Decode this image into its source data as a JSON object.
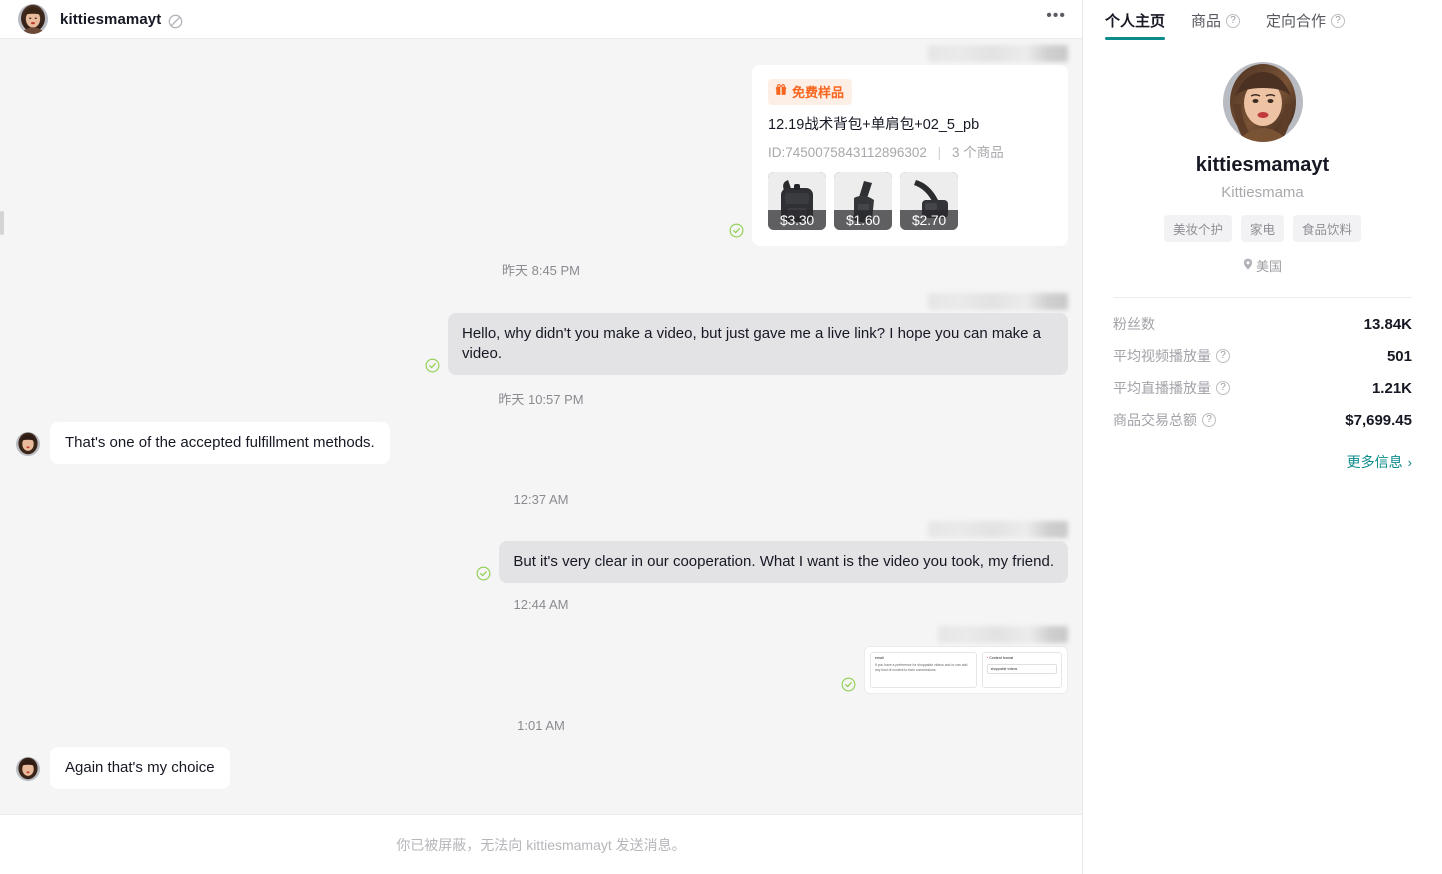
{
  "chat": {
    "header": {
      "username": "kittiesmamayt",
      "ban_icon": "prohibited-icon",
      "more_label": "•••"
    },
    "messages": [
      {
        "kind": "product-card",
        "direction": "out",
        "badge": "免费样品",
        "title": "12.19战术背包+单肩包+02_5_pb",
        "id_text": "ID:7450075843112896302",
        "count_text": "3 个商品",
        "thumbs": [
          {
            "price": "$3.30",
            "alt": "tactical-backpack"
          },
          {
            "price": "$1.60",
            "alt": "sling-bag"
          },
          {
            "price": "$2.70",
            "alt": "shoulder-bag"
          }
        ]
      },
      {
        "kind": "timestamp",
        "text": "昨天 8:45 PM"
      },
      {
        "kind": "text",
        "direction": "out",
        "text": "Hello, why didn't you make a video, but just gave me a live link? I hope you can make a video."
      },
      {
        "kind": "timestamp",
        "text": "昨天 10:57 PM"
      },
      {
        "kind": "text",
        "direction": "in",
        "text": "That's one of the accepted fulfillment methods."
      },
      {
        "kind": "timestamp",
        "text": "12:37 AM"
      },
      {
        "kind": "text",
        "direction": "out",
        "text": "But it's very clear in our cooperation. What I want is the video you took, my friend."
      },
      {
        "kind": "timestamp",
        "text": "12:44 AM"
      },
      {
        "kind": "image",
        "direction": "out",
        "screenshot": {
          "left_label": "email",
          "left_body": "If you have a preference for shoppable videos and or can add any kind of content to earn commissions.",
          "right_label": "Content format",
          "right_value": "shoppable videos"
        }
      },
      {
        "kind": "timestamp",
        "text": "1:01 AM"
      },
      {
        "kind": "text",
        "direction": "in",
        "text": "Again that's my choice"
      }
    ],
    "blocked_notice": "你已被屏蔽，无法向 kittiesmamayt 发送消息。"
  },
  "profile": {
    "tabs": [
      {
        "label": "个人主页",
        "active": true,
        "help": false
      },
      {
        "label": "商品",
        "active": false,
        "help": true
      },
      {
        "label": "定向合作",
        "active": false,
        "help": true
      }
    ],
    "name": "kittiesmamayt",
    "nickname": "Kittiesmama",
    "tags": [
      "美妆个护",
      "家电",
      "食品饮料"
    ],
    "location": "美国",
    "location_icon": "location-pin-icon",
    "stats": [
      {
        "label": "粉丝数",
        "value": "13.84K",
        "help": false
      },
      {
        "label": "平均视频播放量",
        "value": "501",
        "help": true
      },
      {
        "label": "平均直播播放量",
        "value": "1.21K",
        "help": true
      },
      {
        "label": "商品交易总额",
        "value": "$7,699.45",
        "help": true
      }
    ],
    "more_label": "更多信息",
    "more_chevron": "›"
  },
  "colors": {
    "accent_teal": "#0c8b8b",
    "badge_orange": "#f7651e",
    "badge_orange_bg": "#fdefe6",
    "bubble_out": "#e3e3e5",
    "bubble_in": "#ffffff",
    "chat_bg": "#f5f5f5",
    "check_green": "#7ac943"
  }
}
